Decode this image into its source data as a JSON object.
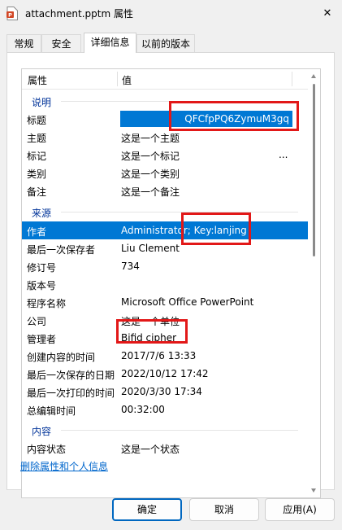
{
  "window": {
    "title": "attachment.pptm 属性",
    "close_glyph": "✕"
  },
  "tabs": [
    {
      "label": "常规"
    },
    {
      "label": "安全"
    },
    {
      "label": "详细信息"
    },
    {
      "label": "以前的版本"
    }
  ],
  "details": {
    "col_property": "属性",
    "col_value": "值",
    "groups": {
      "description": "说明",
      "origin": "来源",
      "content": "内容"
    },
    "description_rows": [
      {
        "key": "标题",
        "value": "QFCfpPQ6ZymuM3gq"
      },
      {
        "key": "主题",
        "value": "这是一个主题"
      },
      {
        "key": "标记",
        "value": "这是一个标记",
        "extra": "..."
      },
      {
        "key": "类别",
        "value": "这是一个类别"
      },
      {
        "key": "备注",
        "value": "这是一个备注"
      }
    ],
    "origin_rows": [
      {
        "key": "作者",
        "value": "Administrator; Key:lanjing"
      },
      {
        "key": "最后一次保存者",
        "value": "Liu Clement"
      },
      {
        "key": "修订号",
        "value": "734"
      },
      {
        "key": "版本号",
        "value": ""
      },
      {
        "key": "程序名称",
        "value": "Microsoft Office PowerPoint"
      },
      {
        "key": "公司",
        "value": "这是一个单位"
      },
      {
        "key": "管理者",
        "value": "Bifid cipher"
      },
      {
        "key": "创建内容的时间",
        "value": "2017/7/6 13:33"
      },
      {
        "key": "最后一次保存的日期",
        "value": "2022/10/12 17:42"
      },
      {
        "key": "最后一次打印的时间",
        "value": "2020/3/30 17:34"
      },
      {
        "key": "总编辑时间",
        "value": "00:32:00"
      }
    ],
    "content_rows": [
      {
        "key": "内容状态",
        "value": "这是一个状态"
      }
    ]
  },
  "remove_link": "删除属性和个人信息",
  "buttons": {
    "ok": "确定",
    "cancel": "取消",
    "apply": "应用(A)"
  },
  "colors": {
    "selection": "#0078d4",
    "highlight_box": "#e21818",
    "group_header": "#003399",
    "link": "#0066cc"
  }
}
